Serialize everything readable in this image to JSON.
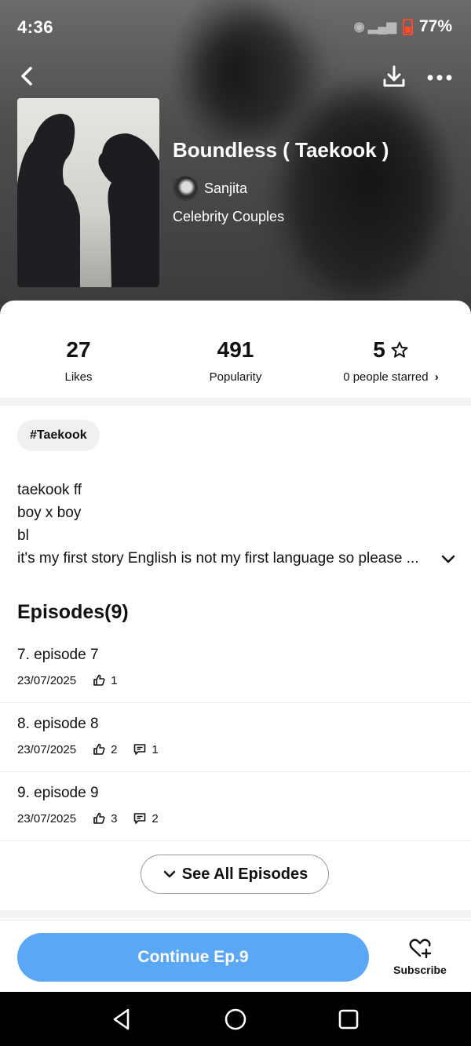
{
  "status_bar": {
    "time": "4:36",
    "battery": "77%"
  },
  "book": {
    "title": "Boundless ( Taekook )",
    "author": "Sanjita",
    "category": "Celebrity Couples"
  },
  "stats": {
    "likes_value": "27",
    "likes_label": "Likes",
    "popularity_value": "491",
    "popularity_label": "Popularity",
    "rating_value": "5",
    "rating_label": "0 people starred"
  },
  "tag": "#Taekook",
  "description": {
    "line1": "taekook ff",
    "line2": "boy x boy",
    "line3": "bl",
    "line4": "it's my first story English is not my first language so please ..."
  },
  "episodes": {
    "heading": "Episodes(9)",
    "items": [
      {
        "title": "7. episode 7",
        "date": "23/07/2025",
        "likes": "1",
        "comments": ""
      },
      {
        "title": "8. episode 8",
        "date": "23/07/2025",
        "likes": "2",
        "comments": "1"
      },
      {
        "title": "9. episode 9",
        "date": "23/07/2025",
        "likes": "3",
        "comments": "2"
      }
    ],
    "see_all_label": "See All Episodes"
  },
  "bottom_bar": {
    "continue_label": "Continue Ep.9",
    "subscribe_label": "Subscribe",
    "accent_color": "#5aa8f5"
  },
  "icons": [
    "back-icon",
    "download-icon",
    "more-icon",
    "star-icon",
    "chevron-right-icon",
    "chevron-down-icon",
    "like-icon",
    "comment-icon",
    "heart-plus-icon",
    "nav-back-icon",
    "nav-home-icon",
    "nav-recents-icon"
  ]
}
